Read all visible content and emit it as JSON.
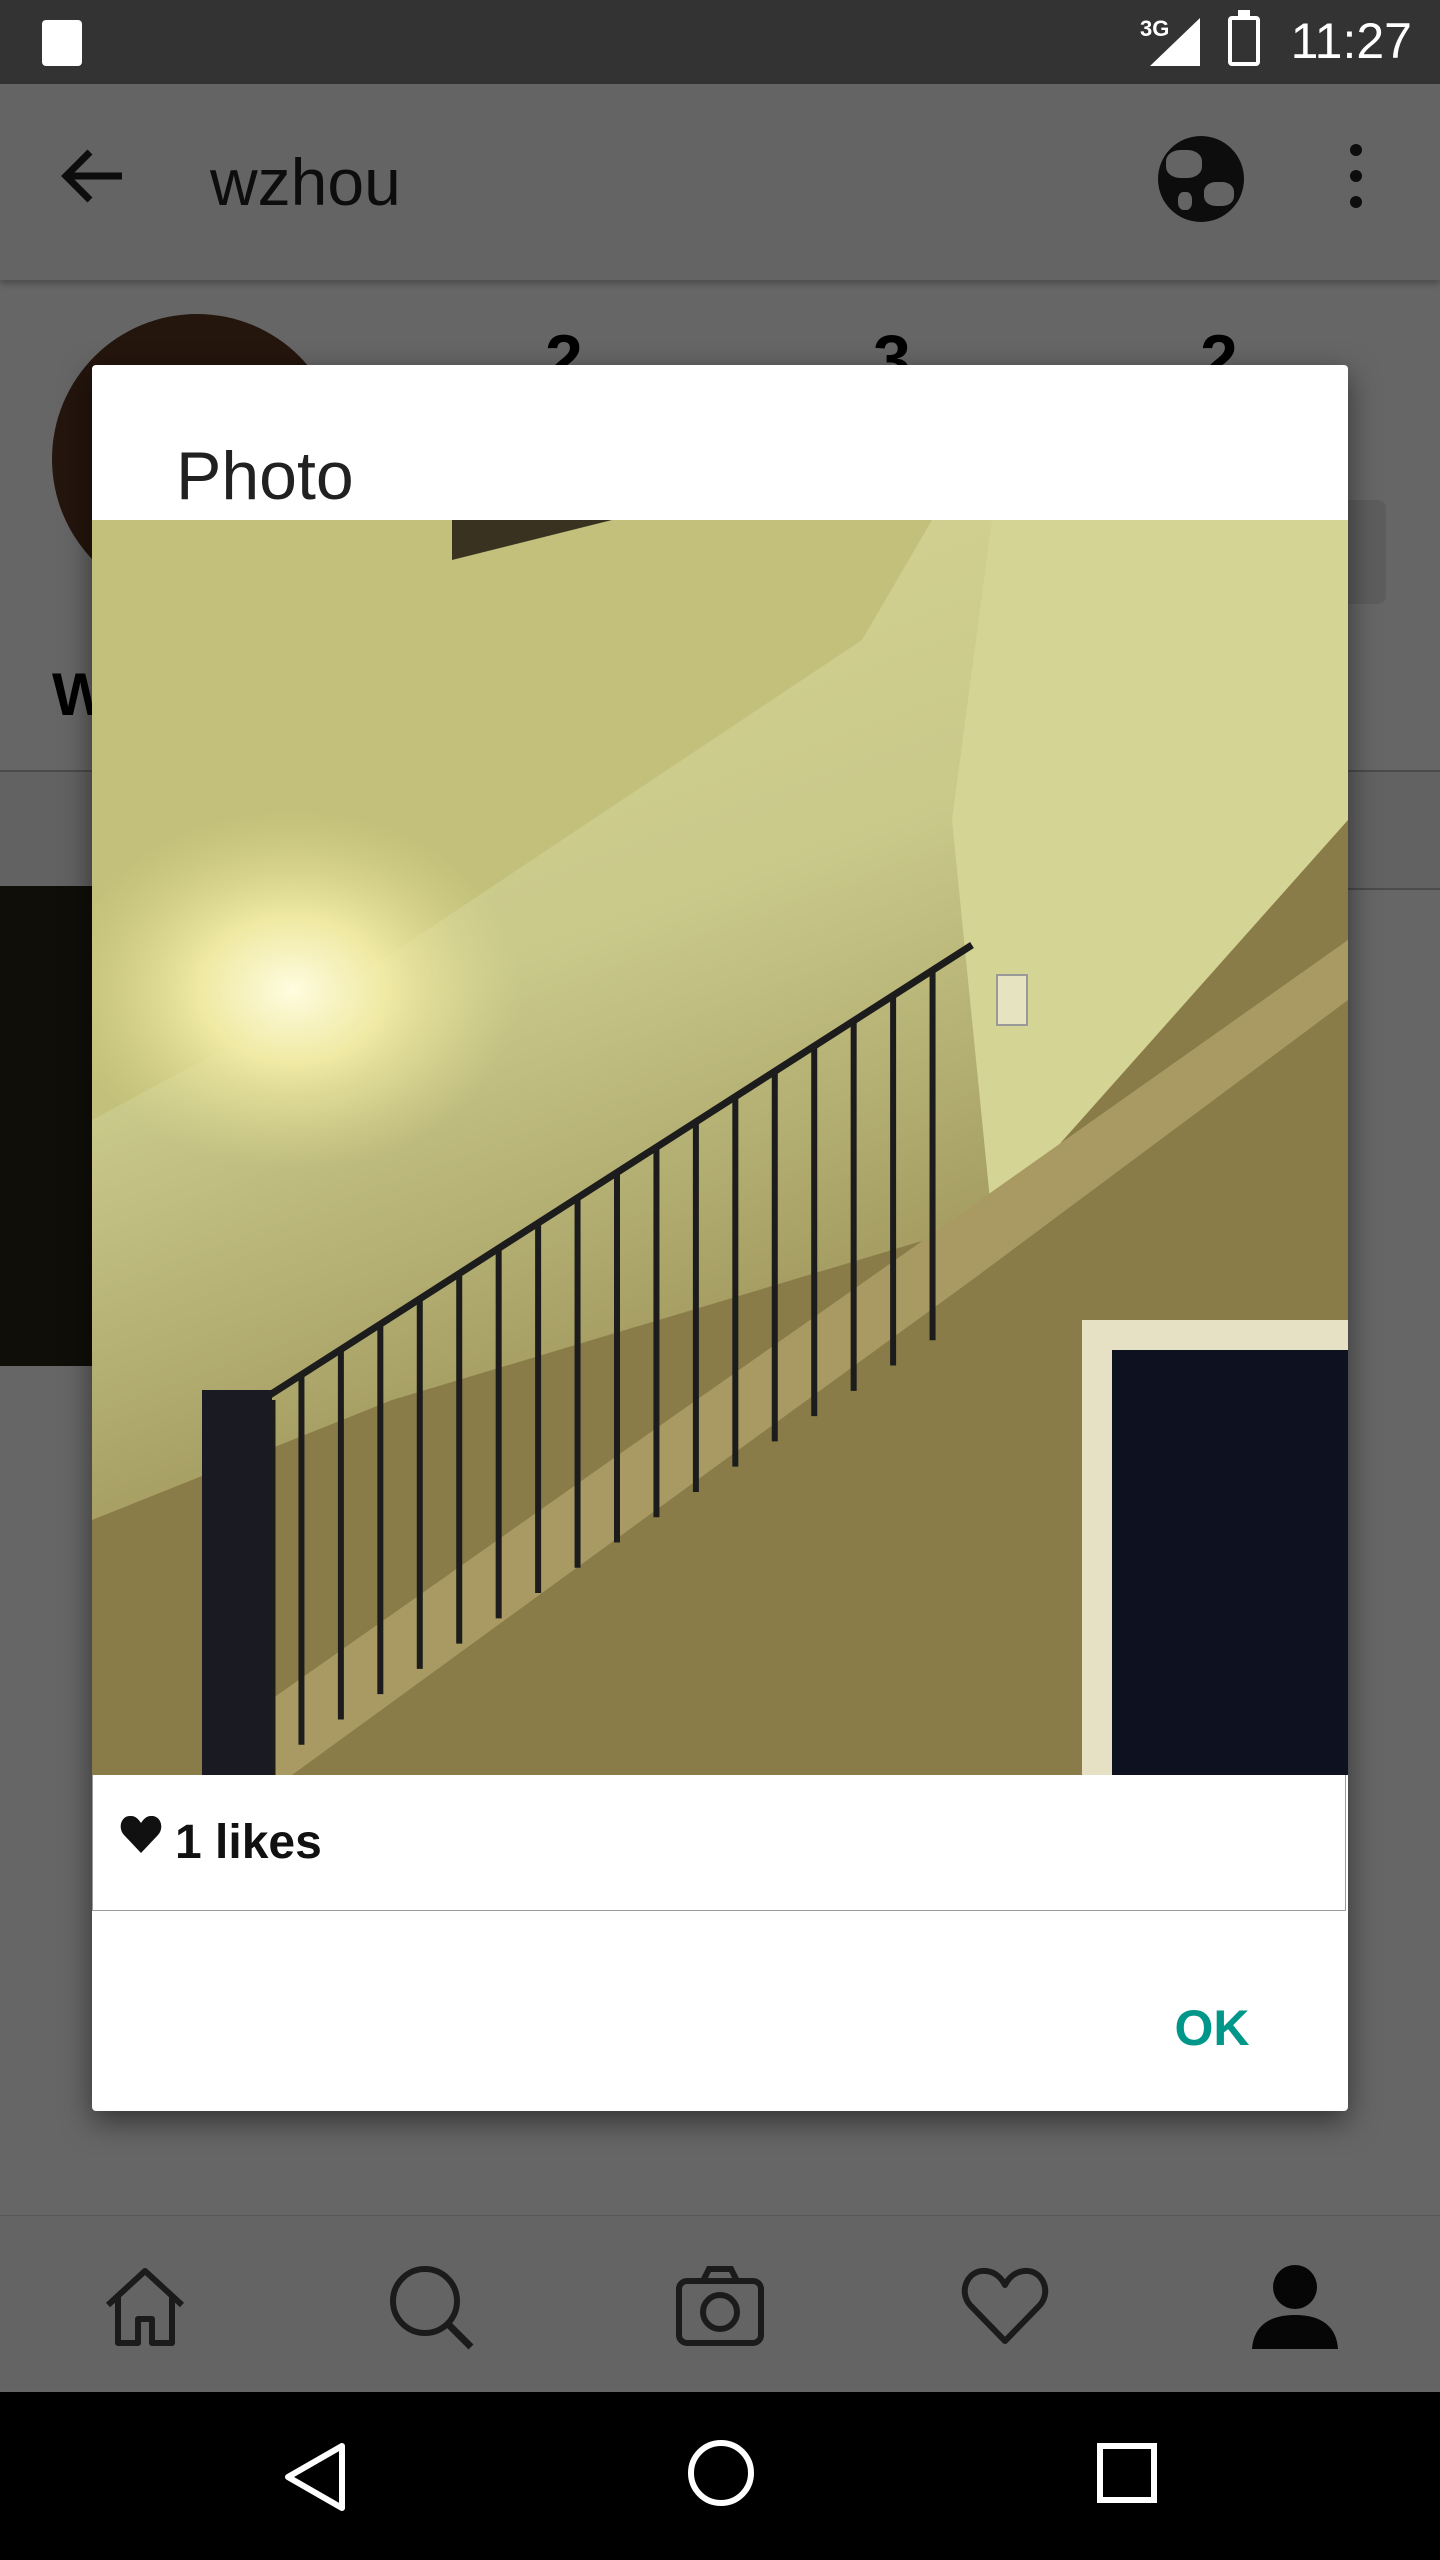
{
  "status_bar": {
    "network": "3G",
    "time": "11:27"
  },
  "app_bar": {
    "back_icon": "arrow-left-icon",
    "title": "wzhou",
    "globe_icon": "globe-icon",
    "menu_icon": "more-vert-icon"
  },
  "profile": {
    "stats": [
      "2",
      "3",
      "2"
    ],
    "name_initial": "W"
  },
  "dialog": {
    "title": "Photo",
    "photo_icon": "staircase-photo",
    "likes_text": "1 likes",
    "heart_icon": "heart-icon",
    "ok_label": "OK",
    "accent_color": "#00968a"
  },
  "bottom_nav": {
    "items": [
      {
        "icon": "home-icon"
      },
      {
        "icon": "search-icon"
      },
      {
        "icon": "camera-icon"
      },
      {
        "icon": "heart-outline-icon"
      },
      {
        "icon": "profile-icon"
      }
    ]
  },
  "system_nav": {
    "back": "back-icon",
    "home": "home-circle-icon",
    "recents": "recents-icon"
  }
}
